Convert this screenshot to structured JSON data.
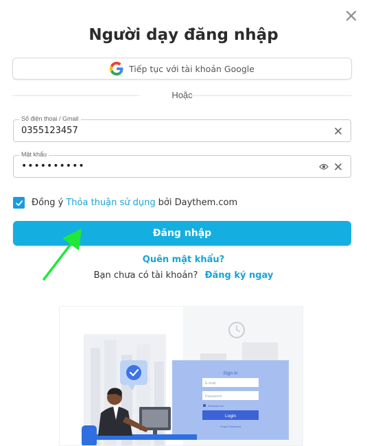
{
  "modal": {
    "title": "Người dạy đăng nhập",
    "google_label": "Tiếp tục với tài khoản Google",
    "divider_text": "Hoặc"
  },
  "form": {
    "phone_label": "Số điện thoại / Gmail",
    "phone_value": "0355123457",
    "password_label": "Mật khẩu",
    "password_value": "••••••••••"
  },
  "agreement": {
    "prefix": "Đồng ý",
    "link": "Thỏa thuận sử dụng",
    "suffix": "bởi Daythem.com",
    "checked": true
  },
  "actions": {
    "login_label": "Đăng nhập",
    "forgot_label": "Quên mật khẩu?",
    "no_account_text": "Bạn chưa có tài khoản?",
    "signup_label": "Đăng ký ngay"
  },
  "illustration": {
    "card_title": "Sign in",
    "email_placeholder": "E-mail",
    "password_placeholder": "Password",
    "remember_label": "Remember me",
    "button_label": "Login",
    "forgot_label": "Forgot Password"
  },
  "colors": {
    "accent": "#15aee0",
    "link": "#19a4d6",
    "arrow": "#1ee83a"
  },
  "icons": {
    "close": "close-icon",
    "google": "google-icon",
    "clear": "clear-icon",
    "eye": "eye-icon",
    "check": "check-icon"
  }
}
